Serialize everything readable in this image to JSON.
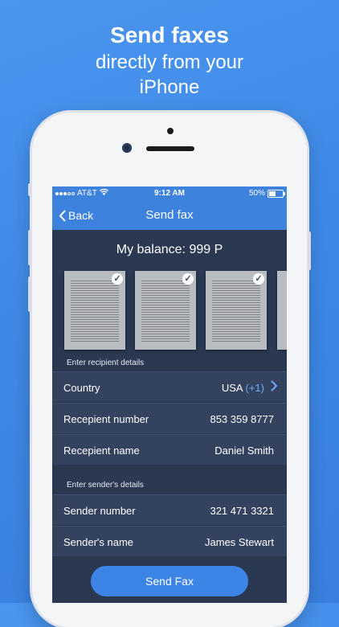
{
  "marketing": {
    "line1": "Send faxes",
    "line2": "directly from your",
    "line3": "iPhone"
  },
  "status_bar": {
    "carrier": "AT&T",
    "time": "9:12 AM",
    "battery": "50%"
  },
  "nav": {
    "back_label": "Back",
    "title": "Send fax"
  },
  "balance": {
    "text": "My balance: 999 P"
  },
  "recipient": {
    "section_label": "Enter recipient details",
    "country_label": "Country",
    "country_value": "USA",
    "country_code": "(+1)",
    "number_label": "Recepient number",
    "number_value": "853 359 8777",
    "name_label": "Recepient name",
    "name_value": "Daniel Smith"
  },
  "sender": {
    "section_label": "Enter sender's details",
    "number_label": "Sender number",
    "number_value": "321 471 3321",
    "name_label": "Sender's name",
    "name_value": "James Stewart"
  },
  "send_button": {
    "label": "Send Fax"
  },
  "colors": {
    "background": "#3f89e6",
    "accent": "#3d82dd",
    "screen": "#2a3851"
  },
  "icons": {
    "back": "chevron-left-icon",
    "country": "chevron-right-icon",
    "check": "checkmark-icon"
  }
}
